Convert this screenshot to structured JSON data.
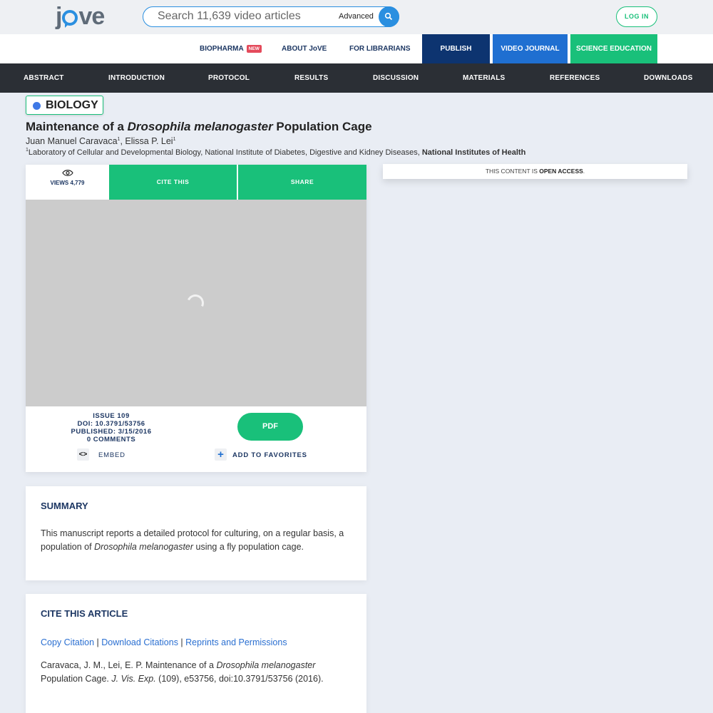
{
  "header": {
    "logo_left": "j",
    "logo_right": "ve",
    "search_placeholder": "Search 11,639 video articles",
    "advanced_label": "Advanced",
    "login_label": "LOG IN"
  },
  "secondary_nav": {
    "biopharma": "BIOPHARMA",
    "new_badge": "NEW",
    "about": "ABOUT JoVE",
    "librarians": "FOR LIBRARIANS",
    "publish": "PUBLISH",
    "video_journal": "VIDEO JOURNAL",
    "science_education": "SCIENCE EDUCATION",
    "colors": {
      "publish": "#0d3470",
      "video_journal": "#1f6fd1",
      "science_education": "#19c07a"
    }
  },
  "section_nav": [
    "ABSTRACT",
    "INTRODUCTION",
    "PROTOCOL",
    "RESULTS",
    "DISCUSSION",
    "MATERIALS",
    "REFERENCES",
    "DOWNLOADS"
  ],
  "article": {
    "category": "BIOLOGY",
    "title_prefix": "Maintenance of a ",
    "title_italic": "Drosophila melanogaster",
    "title_suffix": " Population Cage",
    "author1": "Juan Manuel Caravaca",
    "author1_sup": "1",
    "author_sep": ", ",
    "author2": "Elissa P. Lei",
    "author2_sup": "1",
    "affil_sup": "1",
    "affil_text": "Laboratory of Cellular and Developmental Biology, National Institute of Diabetes, Digestive and Kidney Diseases, ",
    "affil_bold": "National Institutes of Health"
  },
  "video_card": {
    "views_label": "VIEWS 4,779",
    "cite_this": "CITE THIS",
    "share": "SHARE",
    "issue": "ISSUE 109",
    "doi": "DOI: 10.3791/53756",
    "published": "PUBLISHED: 3/15/2016",
    "comments": "0 COMMENTS",
    "pdf": "PDF",
    "embed_icon": "<>",
    "embed": "EMBED",
    "favorites_icon": "+",
    "favorites": "ADD TO FAVORITES"
  },
  "open_access": {
    "prefix": "THIS CONTENT IS ",
    "bold": "OPEN ACCESS",
    "suffix": "."
  },
  "summary": {
    "heading": "SUMMARY",
    "text_a": "This manuscript reports a detailed protocol for culturing, on a regular basis, a population of ",
    "text_italic": "Drosophila melanogaster",
    "text_b": " using a fly population cage."
  },
  "cite_article": {
    "heading": "CITE THIS ARTICLE",
    "copy_citation": "Copy Citation",
    "download_citations": "Download Citations",
    "reprints": "Reprints and Permissions",
    "separator": " | ",
    "cite_a": "Caravaca, J. M., Lei, E. P. Maintenance of a ",
    "cite_italic": "Drosophila melanogaster",
    "cite_b": " Population Cage. ",
    "journal": "J. Vis. Exp.",
    "cite_c": " (109), e53756, doi:10.3791/53756 (2016)."
  }
}
